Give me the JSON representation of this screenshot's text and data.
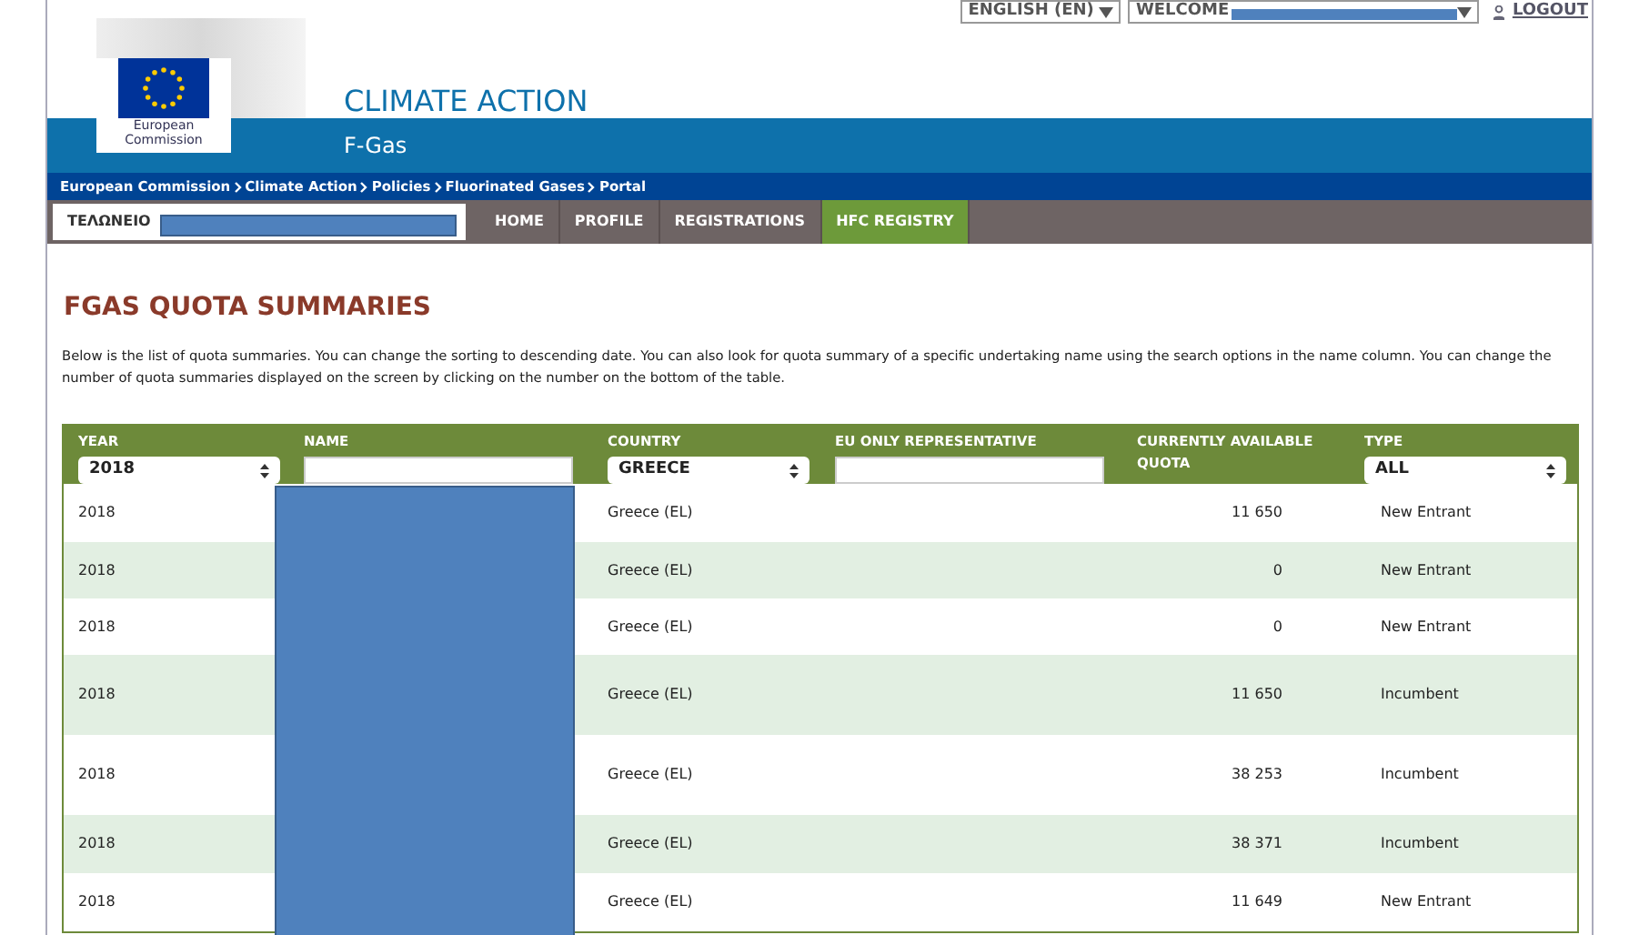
{
  "top_links": {
    "language": "ENGLISH (EN)",
    "welcome": "WELCOME",
    "logout": "LOGOUT"
  },
  "logo": {
    "caption_1": "European",
    "caption_2": "Commission"
  },
  "site": {
    "title": "CLIMATE ACTION",
    "subtitle": "F-Gas"
  },
  "breadcrumb": [
    "European Commission",
    "Climate Action",
    "Policies",
    "Fluorinated Gases",
    "Portal"
  ],
  "user_box": {
    "label": "ΤΕΛΩΝΕΙΟ"
  },
  "menu": [
    {
      "label": "HOME",
      "selected": false
    },
    {
      "label": "PROFILE",
      "selected": false
    },
    {
      "label": "REGISTRATIONS",
      "selected": false
    },
    {
      "label": "HFC REGISTRY",
      "selected": true
    }
  ],
  "heading": "FGAS QUOTA SUMMARIES",
  "intro": "Below is the list of quota summaries. You can change the sorting to descending date. You can also look for quota summary of a specific undertaking name using the search options in the name column. You can change the number of quota summaries displayed on the screen by clicking on the number on the bottom of the table.",
  "table": {
    "columns": [
      {
        "label": "YEAR",
        "filter": {
          "kind": "select",
          "value": "2018"
        }
      },
      {
        "label": "NAME",
        "filter": {
          "kind": "text"
        }
      },
      {
        "label": "COUNTRY",
        "filter": {
          "kind": "select",
          "value": "GREECE"
        }
      },
      {
        "label": "EU ONLY REPRESENTATIVE",
        "filter": {
          "kind": "text"
        }
      },
      {
        "label": "CURRENTLY AVAILABLE QUOTA",
        "filter": {
          "kind": "none"
        }
      },
      {
        "label": "TYPE",
        "filter": {
          "kind": "select",
          "value": "ALL"
        }
      }
    ],
    "rows": [
      {
        "year": "2018",
        "country": "Greece (EL)",
        "quota": "11 650",
        "type": "New Entrant"
      },
      {
        "year": "2018",
        "country": "Greece (EL)",
        "quota": "0",
        "type": "New Entrant"
      },
      {
        "year": "2018",
        "country": "Greece (EL)",
        "quota": "0",
        "type": "New Entrant"
      },
      {
        "year": "2018",
        "country": "Greece (EL)",
        "quota": "11 650",
        "type": "Incumbent"
      },
      {
        "year": "2018",
        "country": "Greece (EL)",
        "quota": "38 253",
        "type": "Incumbent"
      },
      {
        "year": "2018",
        "country": "Greece (EL)",
        "quota": "38 371",
        "type": "Incumbent"
      },
      {
        "year": "2018",
        "country": "Greece (EL)",
        "quota": "11 649",
        "type": "New Entrant"
      }
    ]
  }
}
